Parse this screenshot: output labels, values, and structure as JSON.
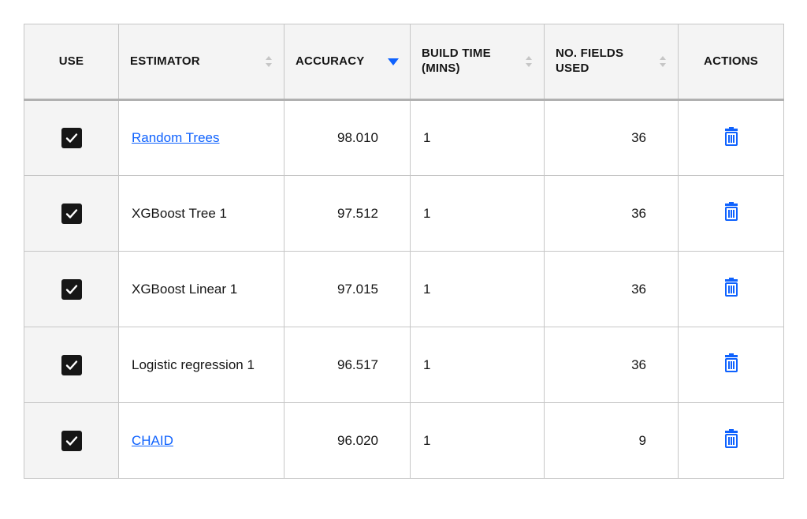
{
  "columns": {
    "use": "USE",
    "estimator": "ESTIMATOR",
    "accuracy": "ACCURACY",
    "build_time": "BUILD TIME (MINS)",
    "fields_used": "NO. FIELDS USED",
    "actions": "ACTIONS"
  },
  "sort": {
    "column": "accuracy",
    "direction": "desc"
  },
  "rows": [
    {
      "use": true,
      "estimator": "Random Trees",
      "is_link": true,
      "accuracy": "98.010",
      "build_time": "1",
      "fields_used": "36"
    },
    {
      "use": true,
      "estimator": "XGBoost Tree 1",
      "is_link": false,
      "accuracy": "97.512",
      "build_time": "1",
      "fields_used": "36"
    },
    {
      "use": true,
      "estimator": "XGBoost Linear 1",
      "is_link": false,
      "accuracy": "97.015",
      "build_time": "1",
      "fields_used": "36"
    },
    {
      "use": true,
      "estimator": "Logistic regression 1",
      "is_link": false,
      "accuracy": "96.517",
      "build_time": "1",
      "fields_used": "36"
    },
    {
      "use": true,
      "estimator": "CHAID",
      "is_link": true,
      "accuracy": "96.020",
      "build_time": "1",
      "fields_used": "9"
    }
  ]
}
